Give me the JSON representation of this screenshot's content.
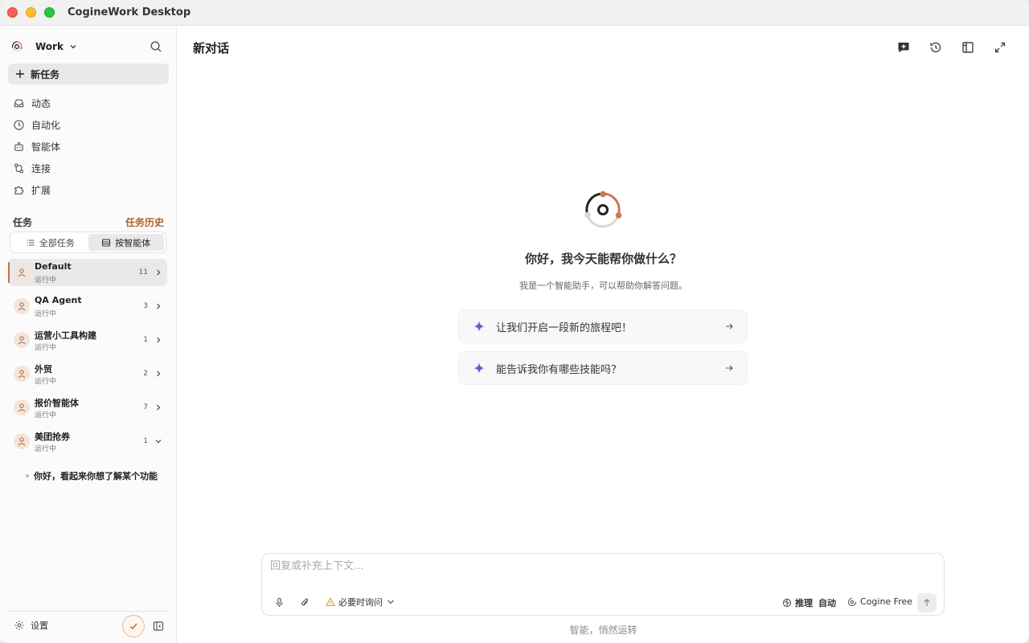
{
  "window": {
    "title": "CogineWork Desktop"
  },
  "sidebar": {
    "workspace": "Work",
    "new_task": "新任务",
    "nav": [
      {
        "label": "动态",
        "icon": "inbox-icon"
      },
      {
        "label": "自动化",
        "icon": "clock-icon"
      },
      {
        "label": "智能体",
        "icon": "robot-icon"
      },
      {
        "label": "连接",
        "icon": "connection-icon"
      },
      {
        "label": "扩展",
        "icon": "puzzle-icon"
      }
    ],
    "tasks_title": "任务",
    "tasks_history": "任务历史",
    "tabs": {
      "all": "全部任务",
      "by_agent": "按智能体"
    },
    "agents": [
      {
        "name": "Default",
        "status": "运行中",
        "count": "11",
        "active": true
      },
      {
        "name": "QA Agent",
        "status": "运行中",
        "count": "3"
      },
      {
        "name": "运营小工具构建",
        "status": "运行中",
        "count": "1"
      },
      {
        "name": "外贸",
        "status": "运行中",
        "count": "2"
      },
      {
        "name": "报价智能体",
        "status": "运行中",
        "count": "7"
      },
      {
        "name": "美团抢券",
        "status": "运行中",
        "count": "1",
        "expanded": true
      }
    ],
    "subtask": "你好，看起来你想了解某个功能",
    "settings": "设置"
  },
  "main": {
    "title": "新对话",
    "greeting": "你好，我今天能帮你做什么？",
    "subtitle": "我是一个智能助手，可以帮助你解答问题。",
    "suggestions": [
      "让我们开启一段新的旅程吧！",
      "能告诉我你有哪些技能吗？"
    ],
    "composer": {
      "placeholder": "回复或补充上下文...",
      "ask_mode": "必要时询问",
      "reasoning_label": "推理",
      "reasoning_value": "自动",
      "model": "Cogine Free"
    },
    "tagline": "智能，悄然运转"
  },
  "colors": {
    "accent": "#c8703a",
    "sparkle": "#6b5bd6",
    "logo_orange": "#c97853"
  }
}
